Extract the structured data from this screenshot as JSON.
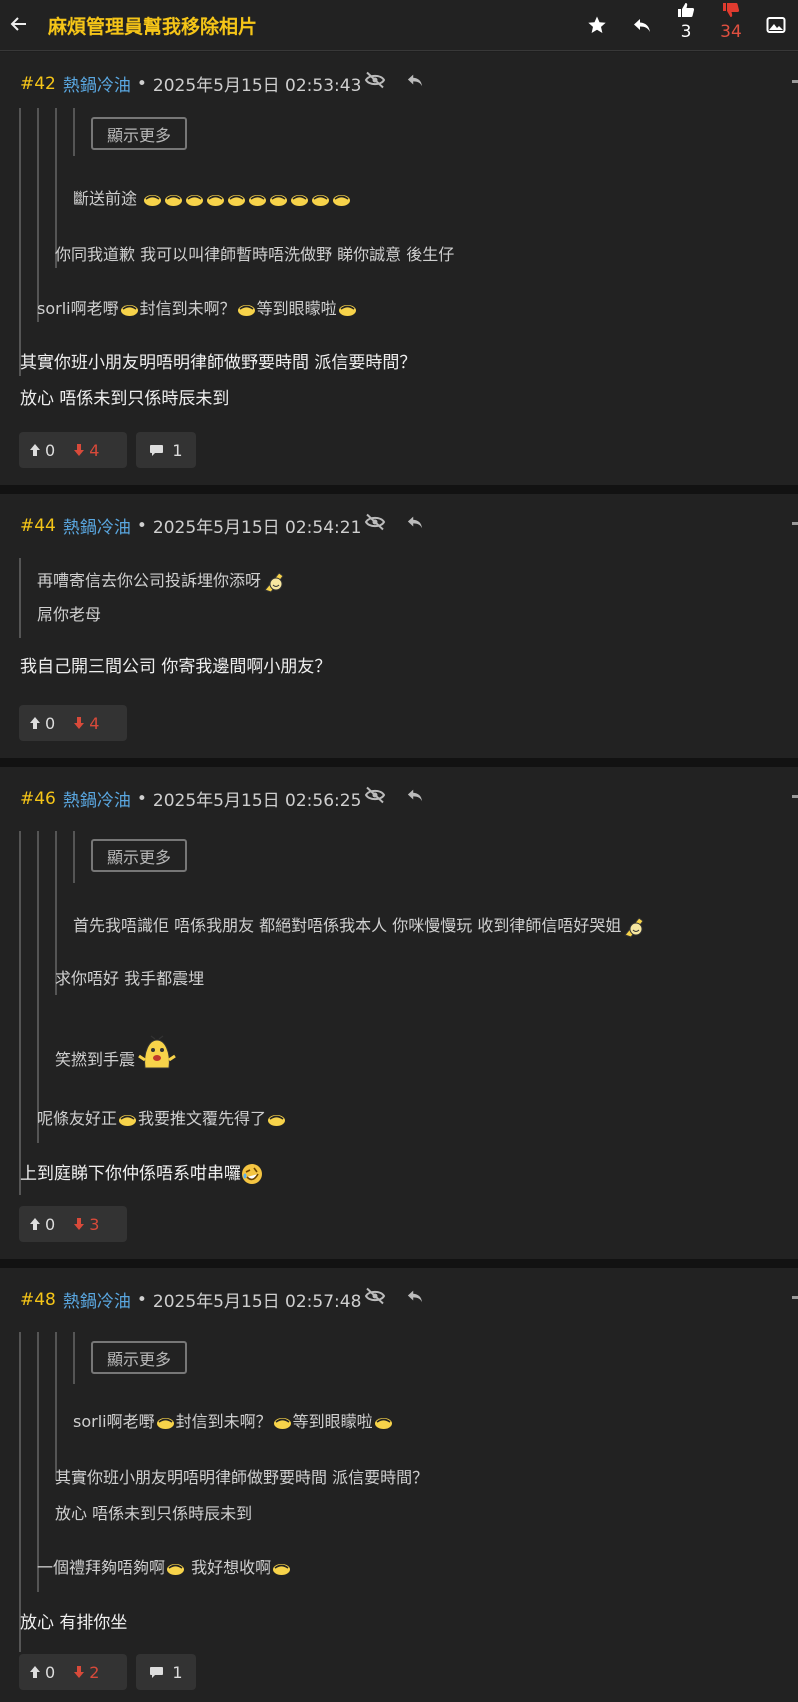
{
  "topbar": {
    "title": "麻煩管理員幫我移除相片",
    "upvotes": "3",
    "downvotes": "34",
    "colors": {
      "title": "#f5c518",
      "downvote": "#d84a3a"
    }
  },
  "posts": [
    {
      "floor": "#42",
      "user": "熱鍋冷油",
      "date": "2025年5月15日 02:53:43",
      "quotes": {
        "show_more": "顯示更多",
        "q2": "斷送前途",
        "q1": "你同我道歉 我可以叫律師暫時唔洗做野 睇你誠意 後生仔",
        "q0a": "sorli啊老嘢",
        "q0b": "封信到未啊？",
        "q0c": "等到眼矇啦"
      },
      "body": [
        "其實你班小朋友明唔明律師做野要時間 派信要時間？",
        "放心 唔係未到只係時辰未到"
      ],
      "up": "0",
      "down": "4",
      "replies": "1"
    },
    {
      "floor": "#44",
      "user": "熱鍋冷油",
      "date": "2025年5月15日 02:54:21",
      "quotes": {
        "l1": "再嘈寄信去你公司投訴埋你添呀",
        "l2": "屌你老母"
      },
      "body": [
        "我自己開三間公司 你寄我邊間啊小朋友？"
      ],
      "up": "0",
      "down": "4"
    },
    {
      "floor": "#46",
      "user": "熱鍋冷油",
      "date": "2025年5月15日 02:56:25",
      "quotes": {
        "show_more": "顯示更多",
        "q2": "首先我唔識佢 唔係我朋友 都絕對唔係我本人 你咪慢慢玩 收到律師信唔好哭姐",
        "q1a": "求你唔好 我手都震埋",
        "q1b": "笑撚到手震",
        "q0a": "呢條友好正",
        "q0b": "我要推文覆先得了"
      },
      "body": [
        "上到庭睇下你仲係唔系咁串囉"
      ],
      "up": "0",
      "down": "3"
    },
    {
      "floor": "#48",
      "user": "熱鍋冷油",
      "date": "2025年5月15日 02:57:48",
      "quotes": {
        "show_more": "顯示更多",
        "q2a": "sorli啊老嘢",
        "q2b": "封信到未啊？",
        "q2c": "等到眼矇啦",
        "q1a": "其實你班小朋友明唔明律師做野要時間 派信要時間？",
        "q1b": "放心 唔係未到只係時辰未到",
        "q0a": "一個禮拜夠唔夠啊",
        "q0b": "我好想收啊"
      },
      "body": [
        "放心 有排你坐"
      ],
      "up": "0",
      "down": "2",
      "replies": "1"
    }
  ]
}
